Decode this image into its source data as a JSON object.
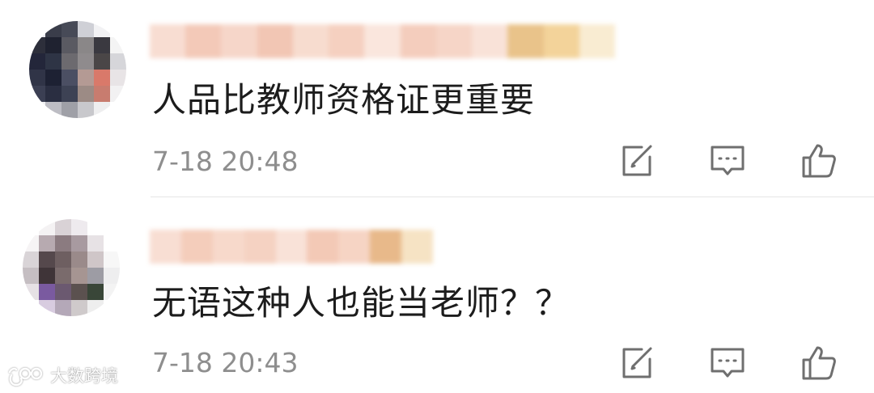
{
  "comments": [
    {
      "text": "人品比教师资格证更重要",
      "time": "7-18 20:48"
    },
    {
      "text": "无语这种人也能当老师？？",
      "time": "7-18 20:43"
    }
  ],
  "actions": {
    "edit_icon": "edit-icon",
    "reply_icon": "comment-icon",
    "like_icon": "thumbs-up-icon"
  },
  "watermark": {
    "text": "大数跨境"
  },
  "colors": {
    "text": "#1c1c1c",
    "meta": "#8e8e8e",
    "icon": "#6f6f6f",
    "divider": "#e6e6e6"
  }
}
